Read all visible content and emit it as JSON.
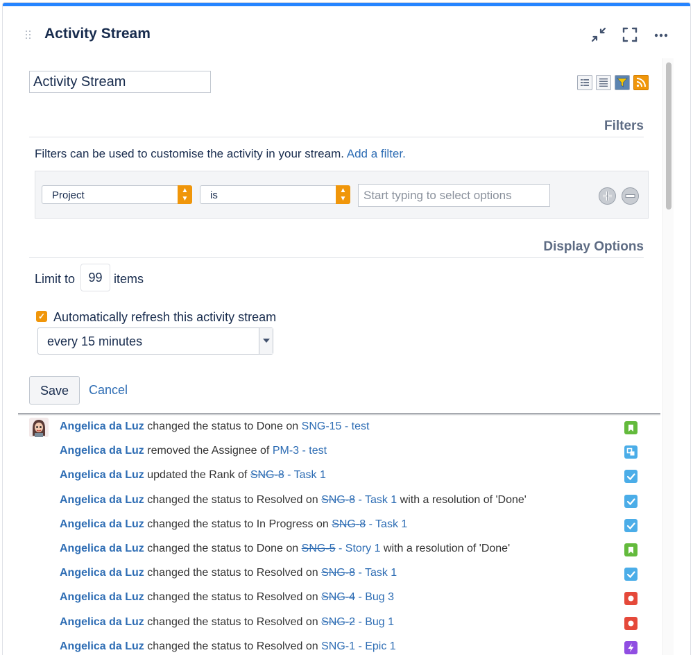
{
  "header": {
    "title": "Activity Stream",
    "minimize_icon": "minimize-icon",
    "fullscreen_icon": "fullscreen-icon",
    "more_icon": "more-icon"
  },
  "config": {
    "title_value": "Activity Stream",
    "filters_heading": "Filters",
    "filters_description": "Filters can be used to customise the activity in your stream.",
    "add_filter_link": "Add a filter.",
    "filter": {
      "field": "Project",
      "operator": "is",
      "value_placeholder": "Start typing to select options"
    },
    "display_heading": "Display Options",
    "limit_prefix": "Limit to",
    "limit_value": "99",
    "limit_suffix": "items",
    "auto_refresh_label": "Automatically refresh this activity stream",
    "auto_refresh_checked": true,
    "interval": "every 15 minutes",
    "save_label": "Save",
    "cancel_label": "Cancel"
  },
  "feed_icons": [
    "full-view-icon",
    "list-view-icon",
    "filter-view-icon",
    "rss-icon"
  ],
  "stream": [
    {
      "user": "Angelica da Luz",
      "action": "changed the status to Done on",
      "key": "SNG-15",
      "summary": "- test",
      "struck": false,
      "suffix": "",
      "type": "story",
      "color": "#63ba3c"
    },
    {
      "user": "Angelica da Luz",
      "action": "removed the Assignee of",
      "key": "PM-3",
      "summary": "- test",
      "struck": false,
      "suffix": "",
      "type": "subtask",
      "color": "#4bade8"
    },
    {
      "user": "Angelica da Luz",
      "action": "updated the Rank of",
      "key": "SNG-8",
      "summary": "- Task 1",
      "struck": true,
      "suffix": "",
      "type": "task",
      "color": "#4bade8"
    },
    {
      "user": "Angelica da Luz",
      "action": "changed the status to Resolved on",
      "key": "SNG-8",
      "summary": "- Task 1",
      "struck": true,
      "suffix": "with a resolution of 'Done'",
      "type": "task",
      "color": "#4bade8"
    },
    {
      "user": "Angelica da Luz",
      "action": "changed the status to In Progress on",
      "key": "SNG-8",
      "summary": "- Task 1",
      "struck": true,
      "suffix": "",
      "type": "task",
      "color": "#4bade8"
    },
    {
      "user": "Angelica da Luz",
      "action": "changed the status to Done on",
      "key": "SNG-5",
      "summary": "- Story 1",
      "struck": true,
      "suffix": "with a resolution of 'Done'",
      "type": "story",
      "color": "#63ba3c"
    },
    {
      "user": "Angelica da Luz",
      "action": "changed the status to Resolved on",
      "key": "SNG-8",
      "summary": "- Task 1",
      "struck": true,
      "suffix": "",
      "type": "task",
      "color": "#4bade8"
    },
    {
      "user": "Angelica da Luz",
      "action": "changed the status to Resolved on",
      "key": "SNG-4",
      "summary": "- Bug 3",
      "struck": true,
      "suffix": "",
      "type": "bug",
      "color": "#e5493a"
    },
    {
      "user": "Angelica da Luz",
      "action": "changed the status to Resolved on",
      "key": "SNG-2",
      "summary": "- Bug 1",
      "struck": true,
      "suffix": "",
      "type": "bug",
      "color": "#e5493a"
    },
    {
      "user": "Angelica da Luz",
      "action": "changed the status to Resolved on",
      "key": "SNG-1",
      "summary": "- Epic 1",
      "struck": false,
      "suffix": "",
      "type": "epic",
      "color": "#904ee2"
    }
  ]
}
